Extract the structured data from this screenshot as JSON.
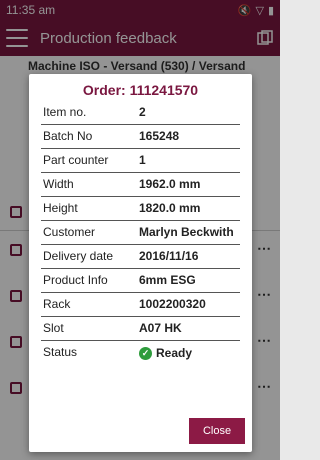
{
  "status_bar": {
    "time": "11:35 am"
  },
  "app_bar": {
    "title": "Production feedback"
  },
  "background": {
    "machine_line": "Machine ISO - Versand (530)   / Versand"
  },
  "dialog": {
    "title": "Order: 111241570",
    "fields": [
      {
        "label": "Item no.",
        "value": "2"
      },
      {
        "label": "Batch No",
        "value": "165248"
      },
      {
        "label": "Part counter",
        "value": "1"
      },
      {
        "label": "Width",
        "value": "1962.0 mm"
      },
      {
        "label": "Height",
        "value": "1820.0 mm"
      },
      {
        "label": "Customer",
        "value": "Marlyn Beckwith"
      },
      {
        "label": "Delivery date",
        "value": "2016/11/16"
      },
      {
        "label": "Product Info",
        "value": "6mm ESG"
      },
      {
        "label": "Rack",
        "value": "1002200320"
      },
      {
        "label": "Slot",
        "value": "A07 HK"
      },
      {
        "label": "Status",
        "value": "Ready"
      }
    ],
    "close_label": "Close"
  }
}
